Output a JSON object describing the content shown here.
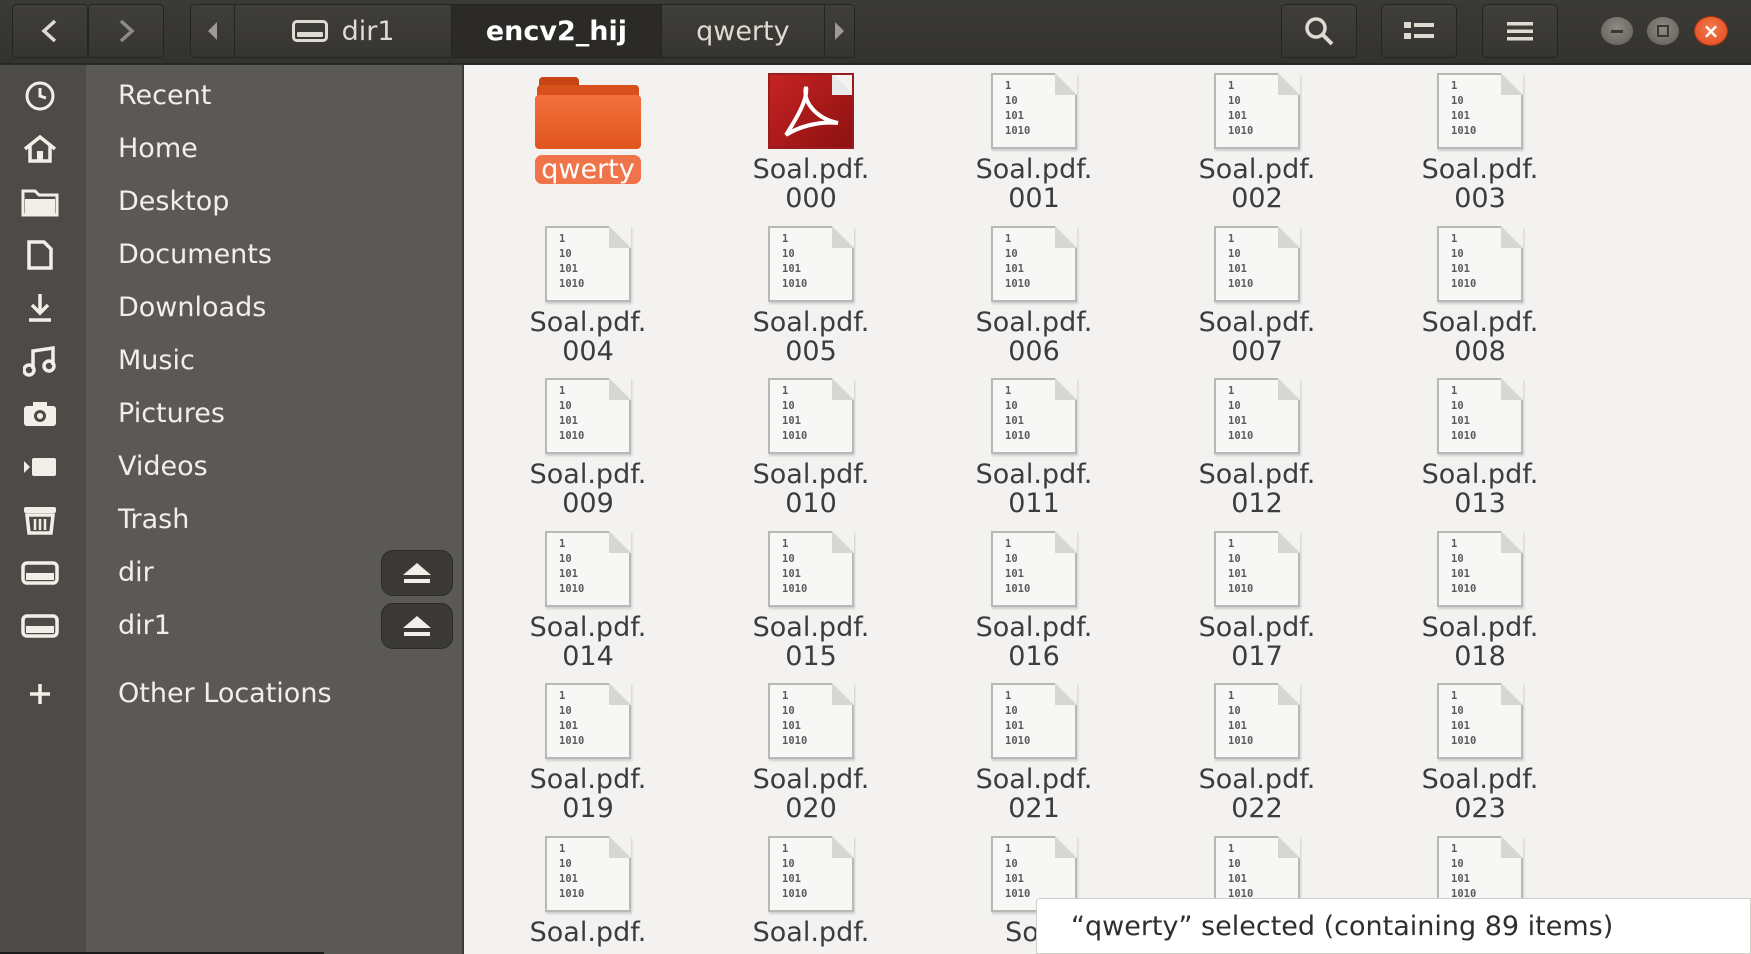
{
  "header": {
    "back_icon": "chevron-left-icon",
    "forward_icon": "chevron-right-icon",
    "path": [
      {
        "label": "dir1",
        "icon": "drive-icon",
        "current": false
      },
      {
        "label": "encv2_hij",
        "current": true
      },
      {
        "label": "qwerty",
        "current": false
      }
    ],
    "search_icon": "search-icon",
    "view_icon": "list-view-icon",
    "menu_icon": "hamburger-menu-icon"
  },
  "sidebar": {
    "items": [
      {
        "label": "Recent",
        "icon": "clock-icon"
      },
      {
        "label": "Home",
        "icon": "home-icon"
      },
      {
        "label": "Desktop",
        "icon": "folder-icon"
      },
      {
        "label": "Documents",
        "icon": "document-icon"
      },
      {
        "label": "Downloads",
        "icon": "download-icon"
      },
      {
        "label": "Music",
        "icon": "music-icon"
      },
      {
        "label": "Pictures",
        "icon": "camera-icon"
      },
      {
        "label": "Videos",
        "icon": "video-icon"
      },
      {
        "label": "Trash",
        "icon": "trash-icon"
      },
      {
        "label": "dir",
        "icon": "drive-icon",
        "eject": true
      },
      {
        "label": "dir1",
        "icon": "drive-icon",
        "eject": true
      },
      {
        "label": "Other Locations",
        "icon": "plus-icon"
      }
    ]
  },
  "files": [
    {
      "line1": "qwerty",
      "line2": "",
      "type": "folder",
      "selected": true
    },
    {
      "line1": "Soal.pdf.",
      "line2": "000",
      "type": "pdf"
    },
    {
      "line1": "Soal.pdf.",
      "line2": "001",
      "type": "binary"
    },
    {
      "line1": "Soal.pdf.",
      "line2": "002",
      "type": "binary"
    },
    {
      "line1": "Soal.pdf.",
      "line2": "003",
      "type": "binary"
    },
    {
      "line1": "Soal.pdf.",
      "line2": "004",
      "type": "binary"
    },
    {
      "line1": "Soal.pdf.",
      "line2": "005",
      "type": "binary"
    },
    {
      "line1": "Soal.pdf.",
      "line2": "006",
      "type": "binary"
    },
    {
      "line1": "Soal.pdf.",
      "line2": "007",
      "type": "binary"
    },
    {
      "line1": "Soal.pdf.",
      "line2": "008",
      "type": "binary"
    },
    {
      "line1": "Soal.pdf.",
      "line2": "009",
      "type": "binary"
    },
    {
      "line1": "Soal.pdf.",
      "line2": "010",
      "type": "binary"
    },
    {
      "line1": "Soal.pdf.",
      "line2": "011",
      "type": "binary"
    },
    {
      "line1": "Soal.pdf.",
      "line2": "012",
      "type": "binary"
    },
    {
      "line1": "Soal.pdf.",
      "line2": "013",
      "type": "binary"
    },
    {
      "line1": "Soal.pdf.",
      "line2": "014",
      "type": "binary"
    },
    {
      "line1": "Soal.pdf.",
      "line2": "015",
      "type": "binary"
    },
    {
      "line1": "Soal.pdf.",
      "line2": "016",
      "type": "binary"
    },
    {
      "line1": "Soal.pdf.",
      "line2": "017",
      "type": "binary"
    },
    {
      "line1": "Soal.pdf.",
      "line2": "018",
      "type": "binary"
    },
    {
      "line1": "Soal.pdf.",
      "line2": "019",
      "type": "binary"
    },
    {
      "line1": "Soal.pdf.",
      "line2": "020",
      "type": "binary"
    },
    {
      "line1": "Soal.pdf.",
      "line2": "021",
      "type": "binary"
    },
    {
      "line1": "Soal.pdf.",
      "line2": "022",
      "type": "binary"
    },
    {
      "line1": "Soal.pdf.",
      "line2": "023",
      "type": "binary"
    },
    {
      "line1": "Soal.pdf.",
      "line2": "",
      "type": "binary"
    },
    {
      "line1": "Soal.pdf.",
      "line2": "",
      "type": "binary"
    },
    {
      "line1": "Soal",
      "line2": "",
      "type": "binary"
    },
    {
      "line1": "",
      "line2": "",
      "type": "binary"
    },
    {
      "line1": "",
      "line2": "",
      "type": "binary"
    }
  ],
  "binary_glyph": "1\n10\n101\n1010",
  "status": {
    "text": "“qwerty” selected  (containing 89 items)"
  },
  "colors": {
    "accent": "#f0744a",
    "sidebar_bg": "#5a5955",
    "header_bg": "#3b3a36",
    "main_bg": "#f3f2f0"
  }
}
